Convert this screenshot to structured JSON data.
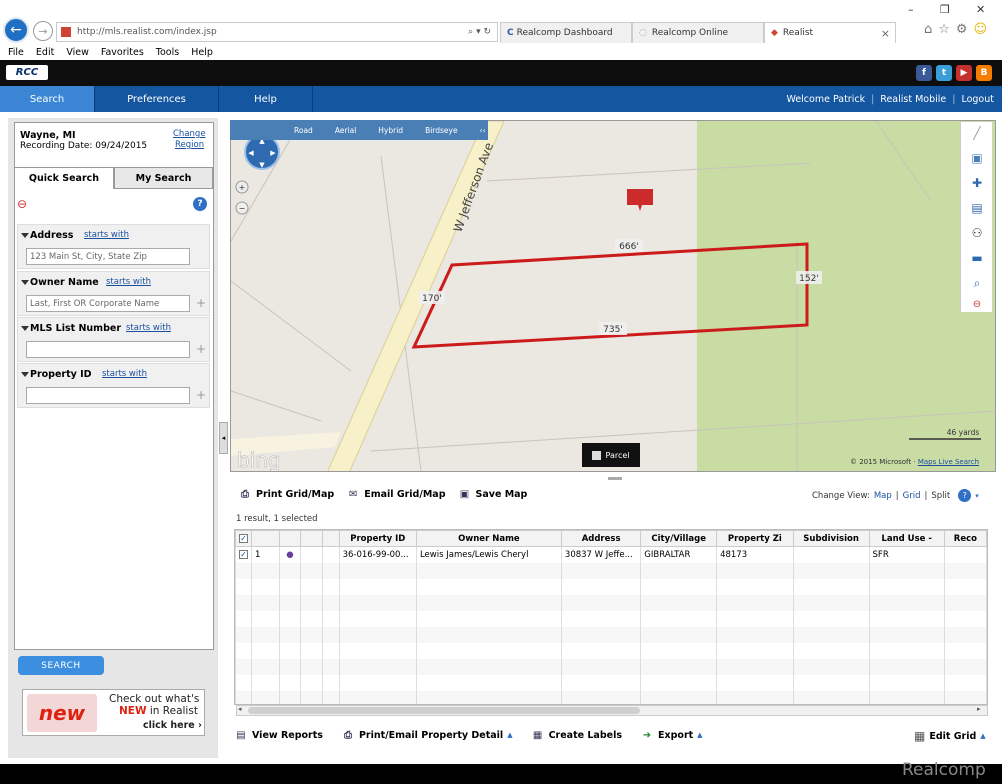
{
  "browser": {
    "url": "http://mls.realist.com/index.jsp",
    "tabs": [
      {
        "label": "Realcomp Dashboard",
        "icon": "cs"
      },
      {
        "label": "Realcomp Online",
        "icon": "loading"
      },
      {
        "label": "Realist",
        "icon": "realist"
      }
    ],
    "tab_close": "×",
    "window_controls": [
      "–",
      "❐",
      "✕"
    ],
    "menu": [
      "File",
      "Edit",
      "View",
      "Favorites",
      "Tools",
      "Help"
    ]
  },
  "app": {
    "logo": "RCC",
    "social": [
      "f",
      "t",
      "▶",
      "B"
    ],
    "nav": [
      "Search",
      "Preferences",
      "Help"
    ],
    "right_nav": [
      "Welcome Patrick",
      "Realist Mobile",
      "Logout"
    ]
  },
  "left": {
    "region": "Wayne, MI",
    "recording_date": "Recording Date: 09/24/2015",
    "change": "Change",
    "region_link": "Region",
    "tabs": [
      "Quick Search",
      "My Search"
    ],
    "fields": [
      {
        "label": "Address",
        "mode": "starts with",
        "placeholder": "123 Main St, City, State Zip"
      },
      {
        "label": "Owner Name",
        "mode": "starts with",
        "placeholder": "Last, First OR Corporate Name"
      },
      {
        "label": "MLS List Number",
        "mode": "starts with",
        "placeholder": ""
      },
      {
        "label": "Property ID",
        "mode": "starts with",
        "placeholder": ""
      }
    ],
    "search_button": "SEARCH",
    "ad": {
      "line1": "Check out what's",
      "new": "NEW",
      "in": "in Realist",
      "cta": "click here ›",
      "badge": "new"
    }
  },
  "map": {
    "tabs": [
      "Road",
      "Aerial",
      "Hybrid",
      "Birdseye"
    ],
    "collapse": "‹‹",
    "street": "W Jefferson Ave",
    "dimensions": {
      "top": "666'",
      "right": "152'",
      "bottom": "735'",
      "left": "170'"
    },
    "parcel": "Parcel",
    "scale": "46 yards",
    "copyright": "© 2015 Microsoft ·",
    "copyright_link": "Maps Live Search",
    "brand": "bing"
  },
  "grid": {
    "toolbar": [
      "Print Grid/Map",
      "Email Grid/Map",
      "Save Map"
    ],
    "change_view": "Change View:",
    "views": [
      "Map",
      "Grid",
      "Split"
    ],
    "count": "1 result, 1 selected",
    "columns": [
      "Property ID",
      "Owner Name",
      "Address",
      "City/Village",
      "Property Zi",
      "Subdivision",
      "Land Use -",
      "Reco"
    ],
    "rows": [
      {
        "n": "1",
        "property_id": "36-016-99-00...",
        "owner": "Lewis James/Lewis Cheryl",
        "address": "30837 W Jeffe...",
        "city": "GIBRALTAR",
        "zip": "48173",
        "subdivision": "",
        "land_use": "SFR",
        "reco": ""
      }
    ],
    "bottom_toolbar": [
      "View Reports",
      "Print/Email Property Detail",
      "Create Labels",
      "Export"
    ],
    "edit_grid": "Edit Grid"
  },
  "watermark": "Realcomp"
}
